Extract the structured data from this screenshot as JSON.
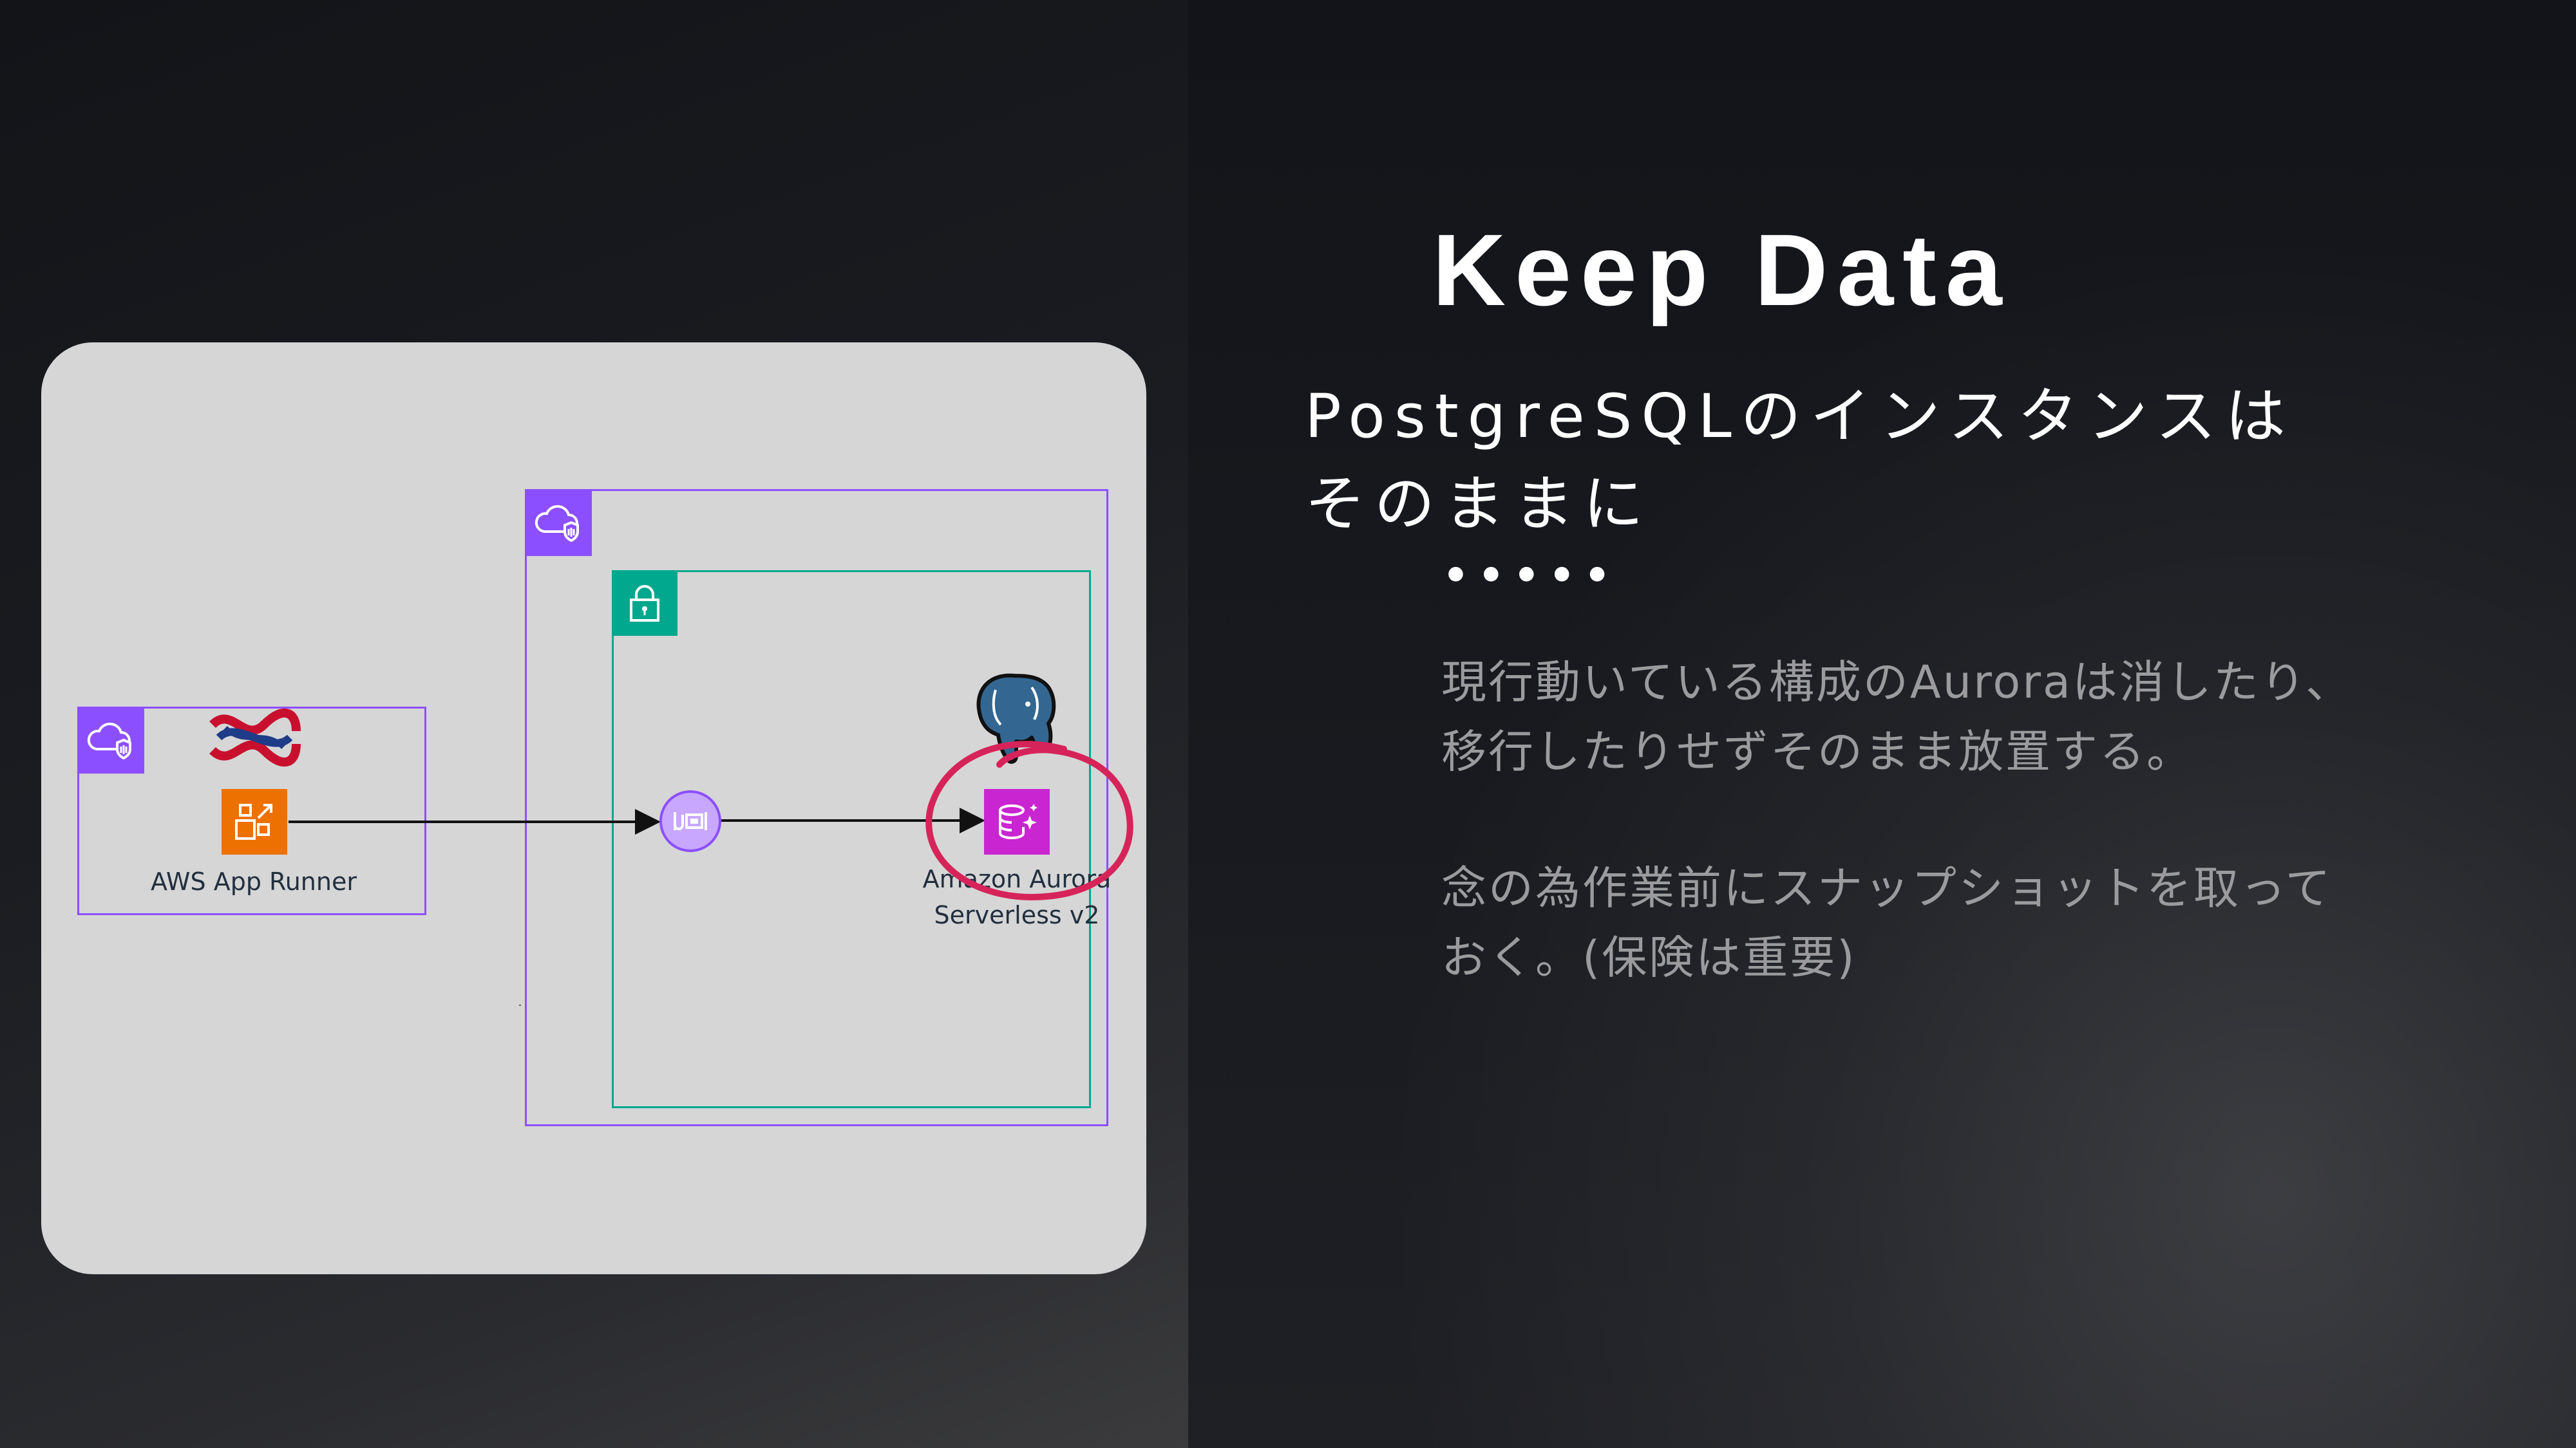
{
  "title": "Keep Data",
  "subtitle_lines": [
    "PostgreSQLのインスタンスは",
    "そのままに"
  ],
  "separator": "•••••",
  "paragraphs": [
    {
      "lines": [
        "現行動いている構成のAuroraは消したり、",
        "移行したりせずそのまま放置する。"
      ]
    },
    {
      "lines": [
        "念の為作業前にスナップショットを取って",
        "おく。(保険は重要)"
      ]
    }
  ],
  "diagram": {
    "app_runner_label": "AWS App Runner",
    "aurora_label_lines": [
      "Amazon Aurora",
      "Serverless v2"
    ]
  },
  "colors": {
    "account_border": "#8c4fff",
    "vpc_border": "#01a88d",
    "app_runner_icon": "#ed7100",
    "aurora_icon": "#c925d1",
    "highlight_circle": "#d6245a",
    "postgres_blue": "#336791"
  },
  "icons": [
    "cloud-account-icon",
    "lock-icon",
    "knot-logo-icon",
    "app-runner-icon",
    "vpc-endpoint-icon",
    "postgresql-elephant-icon",
    "aurora-database-icon"
  ]
}
